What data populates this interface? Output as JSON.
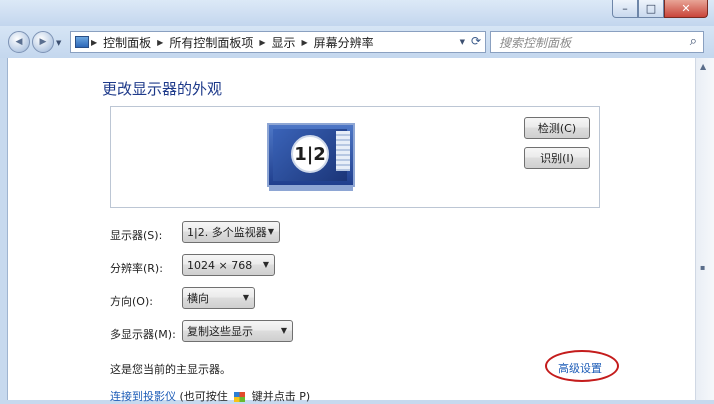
{
  "window": {
    "controls": {
      "minimize": "–",
      "maximize": "□",
      "close": "✕"
    }
  },
  "nav": {
    "back_glyph": "◀",
    "forward_glyph": "▶",
    "breadcrumbs": [
      "控制面板",
      "所有控制面板项",
      "显示",
      "屏幕分辨率"
    ],
    "search_placeholder": "搜索控制面板"
  },
  "page": {
    "title": "更改显示器的外观",
    "monitor_badge": "1|2",
    "detect_button": "检测(C)",
    "identify_button": "识别(I)"
  },
  "settings": [
    {
      "label": "显示器(S):",
      "value": "1|2. 多个监视器"
    },
    {
      "label": "分辨率(R):",
      "value": "1024 × 768"
    },
    {
      "label": "方向(O):",
      "value": "横向"
    },
    {
      "label": "多显示器(M):",
      "value": "复制这些显示"
    }
  ],
  "status": {
    "primary_text": "这是您当前的主显示器。",
    "advanced_link": "高级设置"
  },
  "footer": {
    "project_link": "连接到投影仪",
    "tail_text": "(也可按住",
    "tail_text2": "键并点击 P)"
  },
  "colors": {
    "link": "#1d5cb7",
    "title": "#1e3a8a",
    "highlight_circle": "#c41c1c"
  },
  "icons": [
    "back-icon",
    "forward-icon",
    "control-panel-icon",
    "refresh-icon",
    "search-icon",
    "windows-logo-icon"
  ]
}
